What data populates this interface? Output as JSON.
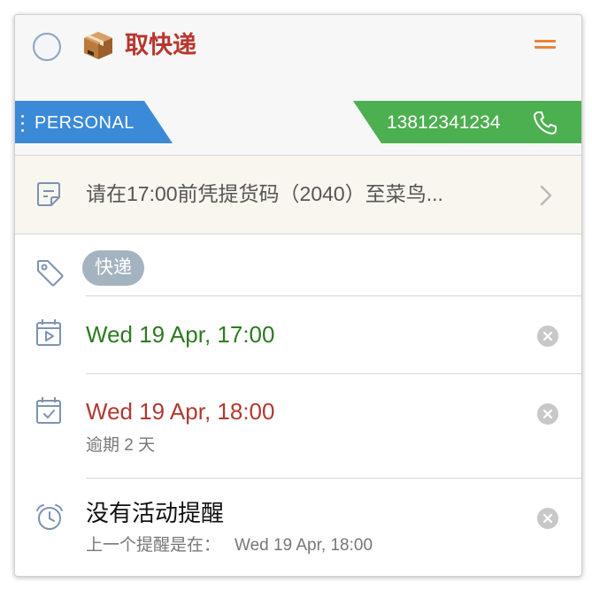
{
  "task": {
    "title": "取快递",
    "title_color": "#b8362e",
    "icon": "package-icon"
  },
  "list_tag": {
    "label": "PERSONAL",
    "color": "#3a8ad8"
  },
  "contact": {
    "phone": "13812341234",
    "color": "#4caf50",
    "icon": "phone-icon"
  },
  "note": {
    "text": "请在17:00前凭提货码（2040）至菜鸟...",
    "icon": "note-icon"
  },
  "tags": {
    "items": [
      "快递"
    ],
    "icon": "tag-icon"
  },
  "start_date": {
    "value": "Wed 19 Apr, 17:00",
    "color": "#2e7a22",
    "icon": "calendar-play-icon"
  },
  "due_date": {
    "value": "Wed 19 Apr, 18:00",
    "color": "#b03a30",
    "overdue": "逾期 2 天",
    "icon": "calendar-check-icon"
  },
  "reminder": {
    "title": "没有活动提醒",
    "previous_label": "上一个提醒是在：",
    "previous_value": "Wed 19 Apr, 18:00",
    "icon": "alarm-clock-icon"
  }
}
